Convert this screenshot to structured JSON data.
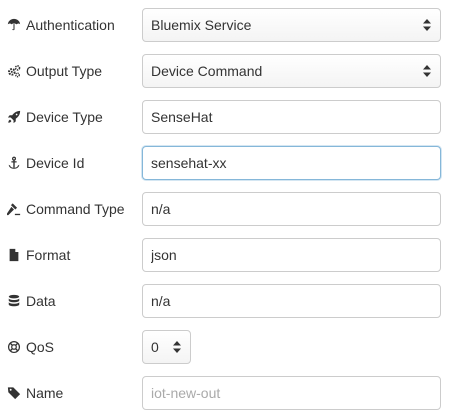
{
  "fields": {
    "authentication": {
      "label": "Authentication",
      "icon": "umbrella-icon",
      "value": "Bluemix Service"
    },
    "output_type": {
      "label": "Output Type",
      "icon": "gears-icon",
      "value": "Device Command"
    },
    "device_type": {
      "label": "Device Type",
      "icon": "rocket-icon",
      "value": "SenseHat"
    },
    "device_id": {
      "label": "Device Id",
      "icon": "anchor-icon",
      "value": "sensehat-xx"
    },
    "command_type": {
      "label": "Command Type",
      "icon": "gavel-icon",
      "value": "n/a"
    },
    "format": {
      "label": "Format",
      "icon": "file-icon",
      "value": "json"
    },
    "data": {
      "label": "Data",
      "icon": "database-icon",
      "value": "n/a"
    },
    "qos": {
      "label": "QoS",
      "icon": "life-ring-icon",
      "value": "0"
    },
    "name": {
      "label": "Name",
      "icon": "tag-icon",
      "value": "",
      "placeholder": "iot-new-out"
    }
  }
}
